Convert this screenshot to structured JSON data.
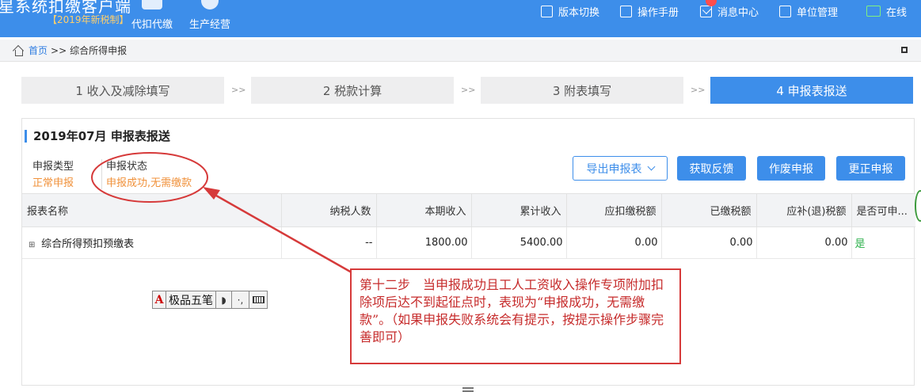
{
  "header": {
    "app_title": "星系统扣缴客户端",
    "edition": "【2019年新税制】",
    "nav_tiles": [
      "代扣代缴",
      "生产经营"
    ],
    "tools": [
      "版本切换",
      "操作手册",
      "消息中心",
      "单位管理",
      "在线"
    ]
  },
  "breadcrumb": {
    "home": "首页",
    "separator": ">>",
    "current": "综合所得申报"
  },
  "steps": [
    {
      "label": "1 收入及减除填写"
    },
    {
      "label": "2 税款计算"
    },
    {
      "label": "3 附表填写"
    },
    {
      "label": "4 申报表报送"
    }
  ],
  "step_separator": ">>",
  "panel": {
    "title": "2019年07月  申报表报送",
    "declaration_type_label": "申报类型",
    "declaration_type_value": "正常申报",
    "declaration_status_label": "申报状态",
    "declaration_status_value": "申报成功,无需缴款"
  },
  "buttons": {
    "export": "导出申报表",
    "get_feedback": "获取反馈",
    "void": "作废申报",
    "correct": "更正申报"
  },
  "table": {
    "headers": [
      "报表名称",
      "纳税人数",
      "本期收入",
      "累计收入",
      "应扣缴税额",
      "已缴税额",
      "应补(退)税额",
      "是否可申..."
    ],
    "rows": [
      [
        "综合所得预扣预缴表",
        "--",
        "1800.00",
        "5400.00",
        "0.00",
        "0.00",
        "0.00",
        "是"
      ]
    ]
  },
  "ime": {
    "a": "A",
    "name": "极品五笔",
    "moon": "◗",
    "punct": "·,"
  },
  "annotation": {
    "text": "第十二步　当申报成功且工人工资收入操作专项附加扣除项后达不到起征点时，表现为“申报成功，无需缴款”。（如果申报失败系统会有提示，按提示操作步骤完善即可）"
  },
  "colors": {
    "brand": "#3d8eea",
    "status_orange": "#f0913a",
    "annotation_red": "#d63a3a",
    "yes_green": "#2bb04a"
  }
}
